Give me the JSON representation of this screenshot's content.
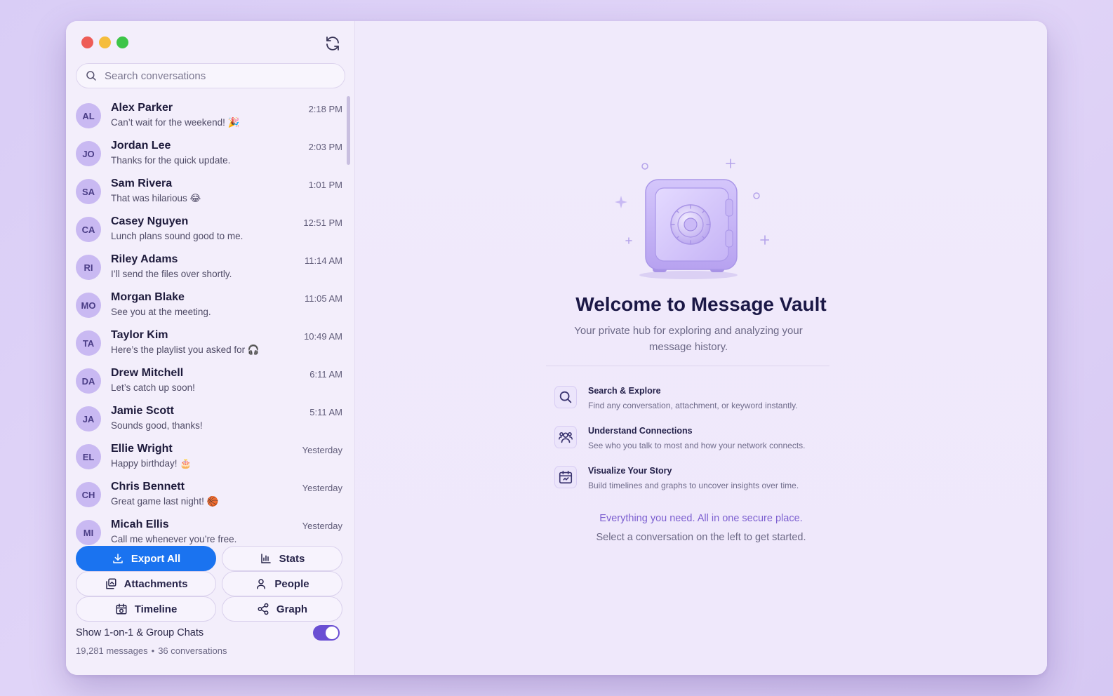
{
  "search": {
    "placeholder": "Search conversations"
  },
  "conversations": [
    {
      "initials": "AL",
      "name": "Alex Parker",
      "preview": "Can’t wait for the weekend! 🎉",
      "time": "2:18 PM"
    },
    {
      "initials": "JO",
      "name": "Jordan Lee",
      "preview": "Thanks for the quick update.",
      "time": "2:03 PM"
    },
    {
      "initials": "SA",
      "name": "Sam Rivera",
      "preview": "That was hilarious 😂",
      "time": "1:01 PM"
    },
    {
      "initials": "CA",
      "name": "Casey Nguyen",
      "preview": "Lunch plans sound good to me.",
      "time": "12:51 PM"
    },
    {
      "initials": "RI",
      "name": "Riley Adams",
      "preview": "I’ll send the files over shortly.",
      "time": "11:14 AM"
    },
    {
      "initials": "MO",
      "name": "Morgan Blake",
      "preview": "See you at the meeting.",
      "time": "11:05 AM"
    },
    {
      "initials": "TA",
      "name": "Taylor Kim",
      "preview": "Here’s the playlist you asked for 🎧",
      "time": "10:49 AM"
    },
    {
      "initials": "DA",
      "name": "Drew Mitchell",
      "preview": "Let’s catch up soon!",
      "time": "6:11 AM"
    },
    {
      "initials": "JA",
      "name": "Jamie Scott",
      "preview": "Sounds good, thanks!",
      "time": "5:11 AM"
    },
    {
      "initials": "EL",
      "name": "Ellie Wright",
      "preview": "Happy birthday! 🎂",
      "time": "Yesterday"
    },
    {
      "initials": "CH",
      "name": "Chris Bennett",
      "preview": "Great game last night! 🏀",
      "time": "Yesterday"
    },
    {
      "initials": "MI",
      "name": "Micah Ellis",
      "preview": "Call me whenever you’re free.",
      "time": "Yesterday"
    }
  ],
  "actions": {
    "export_all": "Export All",
    "stats": "Stats",
    "attachments": "Attachments",
    "people": "People",
    "timeline": "Timeline",
    "graph": "Graph"
  },
  "toggle": {
    "label": "Show 1-on-1 & Group Chats",
    "on": true
  },
  "footer": {
    "messages": "19,281 messages",
    "separator": "•",
    "conversations": "36 conversations"
  },
  "welcome": {
    "title": "Welcome to Message Vault",
    "subtitle": "Your private hub for exploring and analyzing your message history.",
    "features": [
      {
        "icon": "search-icon",
        "title": "Search & Explore",
        "description": "Find any conversation, attachment, or keyword instantly."
      },
      {
        "icon": "people-icon",
        "title": "Understand Connections",
        "description": "See who you talk to most and how your network connects."
      },
      {
        "icon": "calendar-icon",
        "title": "Visualize Your Story",
        "description": "Build timelines and graphs to uncover insights over time."
      }
    ],
    "tagline": "Everything you need. All in one secure place.",
    "hint": "Select a conversation on the left to get started."
  },
  "colors": {
    "accent": "#1a73f0",
    "toggle": "#6a4fd3",
    "avatar_bg": "#c9b9f2",
    "avatar_text": "#4a3d86"
  }
}
